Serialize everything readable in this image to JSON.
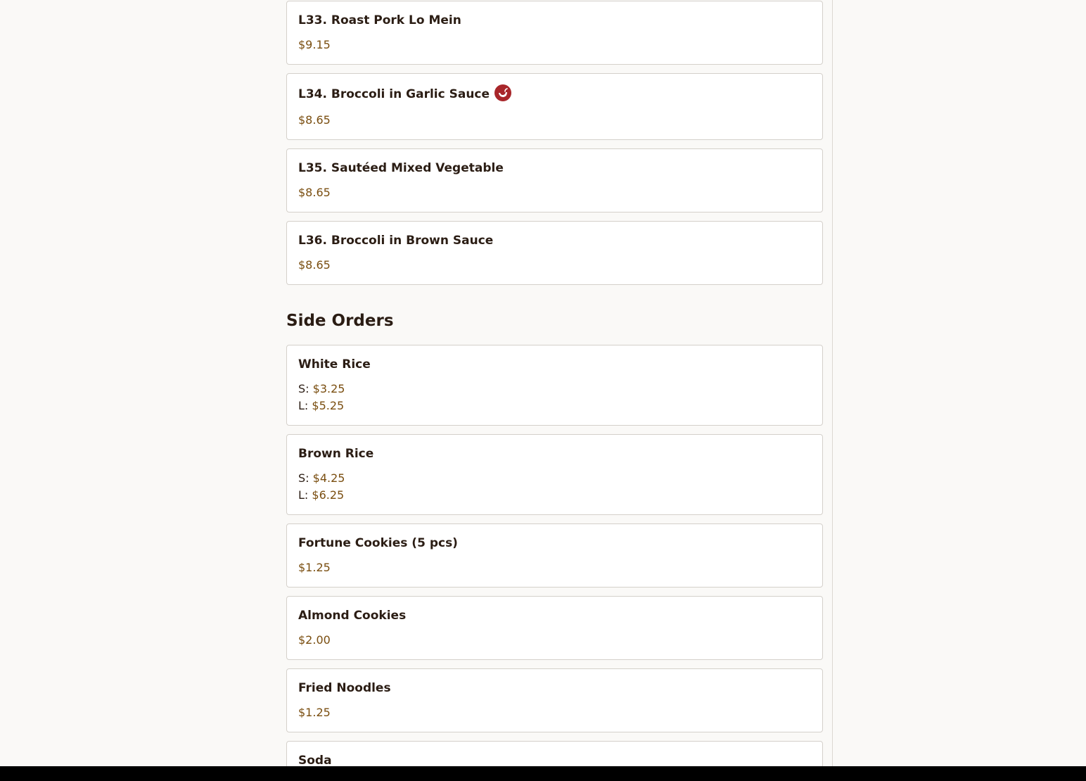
{
  "items_top": [
    {
      "name": "L33. Roast Pork Lo Mein",
      "price": "$9.15",
      "spicy": false
    },
    {
      "name": "L34. Broccoli in Garlic Sauce",
      "price": "$8.65",
      "spicy": true
    },
    {
      "name": "L35. Sautéed Mixed Vegetable",
      "price": "$8.65",
      "spicy": false
    },
    {
      "name": "L36. Broccoli in Brown Sauce",
      "price": "$8.65",
      "spicy": false
    }
  ],
  "side_orders": {
    "title": "Side Orders",
    "items": [
      {
        "name": "White Rice",
        "small_label": "S:",
        "small_price": "$3.25",
        "large_label": "L:",
        "large_price": "$5.25"
      },
      {
        "name": "Brown Rice",
        "small_label": "S:",
        "small_price": "$4.25",
        "large_label": "L:",
        "large_price": "$6.25"
      },
      {
        "name": "Fortune Cookies (5 pcs)",
        "price": "$1.25"
      },
      {
        "name": "Almond Cookies",
        "price": "$2.00"
      },
      {
        "name": "Fried Noodles",
        "price": "$1.25"
      },
      {
        "name": "Soda"
      }
    ]
  },
  "colors": {
    "price": "#7a4e10",
    "spicy_badge": "#a8262a",
    "text": "#2b1d14",
    "background": "#faf9f7"
  },
  "icons": {
    "spicy": "chili-pepper-icon"
  }
}
